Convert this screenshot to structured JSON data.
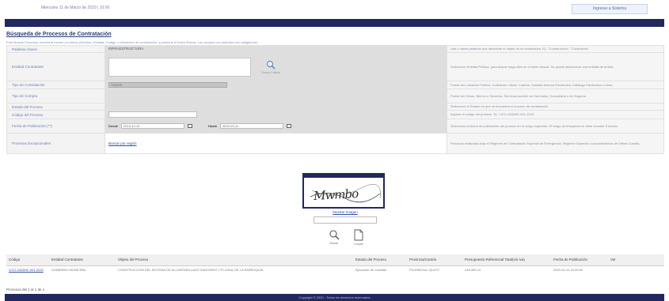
{
  "header": {
    "date": "Miércoles 11 de Marzo de 2020 | 10:00",
    "entity_button": "Ingresar a Sistema"
  },
  "page": {
    "title": "Búsqueda de Procesos de Contratación",
    "description": "Para Buscar Procesos, escriba al menos un criterio (Nombre, Entidad, Código o Ubicación) de contratación, y presione el botón Buscar. Los campos con asterisco son obligatorios."
  },
  "form": {
    "rows": [
      {
        "label": "Palabras claves",
        "value": "INFRAESTRUCTURA",
        "help": "Una o varias palabras que describan el objeto de la contratación. Ej.: \"Construcción\", \"Consultoría\""
      },
      {
        "label": "Entidad Contratante",
        "search_label": "Buscar Entidad",
        "help": "Seleccione Entidad Pública, para buscar haga click en el botón buscar. Se puede seleccionar una entidad de la lista."
      },
      {
        "label": "Tipo de Contratación",
        "value": "TODOS",
        "help": "Puede ser Licitación Pública, Cotización, Menor Cuantía, Subasta Inversa Electrónica, Catálogo Electrónico u otros."
      },
      {
        "label": "Tipo de Compra",
        "help": "Puede ser Obras, Bienes o Servicios. Servicios pueden ser Normales, Consultoría o de Seguros."
      },
      {
        "label": "Estado del Proceso",
        "help": "Seleccione el Estado en que se encuentra el proceso de contratación."
      },
      {
        "label": "Código del Proceso",
        "help": "Ingrese el código del proceso. Ej.: LICO-GADMC-001-2019"
      },
      {
        "label": "Fecha de Publicación (**)",
        "from_label": "Desde",
        "from_value": "2019-12-12",
        "to_label": "Hasta",
        "to_value": "2020-03-11",
        "help": "Seleccione la fecha de publicación del proceso en el rango requerido. El rango de búsqueda no debe exceder 6 meses."
      },
      {
        "label": "Procesos Excepcionales",
        "link": "Buscar por región",
        "help": "Procesos realizados bajo el Régimen de Contratación Especial de Emergencia, Régimen Especial o procedimientos de Ínfima Cuantía."
      }
    ]
  },
  "captcha": {
    "text": "Mwmbo",
    "refresh_link": "Mostrar Imagen",
    "search_label": "Buscar",
    "clear_label": "Limpiar"
  },
  "results": {
    "columns": [
      "Código",
      "Entidad Contratante",
      "Objeto del Proceso",
      "Estado del Proceso",
      "Provincia/Cantón",
      "Presupuesto Referencial Total(sin iva)",
      "Fecha de Publicación",
      "Ver"
    ],
    "rows": [
      {
        "code": "LICO-GADMC-001-2020",
        "entity": "GOBIERNO MUNICIPAL",
        "object": "CONSTRUCCIÓN DEL SISTEMA DE ALCANTARILLADO SANITARIO Y PLUVIAL DE LA PARROQUIA",
        "status": "Ejecución de Contrato",
        "province": "PICHINCHA / QUITO",
        "budget": "248.490,10",
        "date": "2020-02-14 10:00:00"
      }
    ],
    "count": "Procesos del 1 al 1 de 1"
  },
  "footer": {
    "text": "Copyright © 2020 - Todos los derechos reservados"
  }
}
